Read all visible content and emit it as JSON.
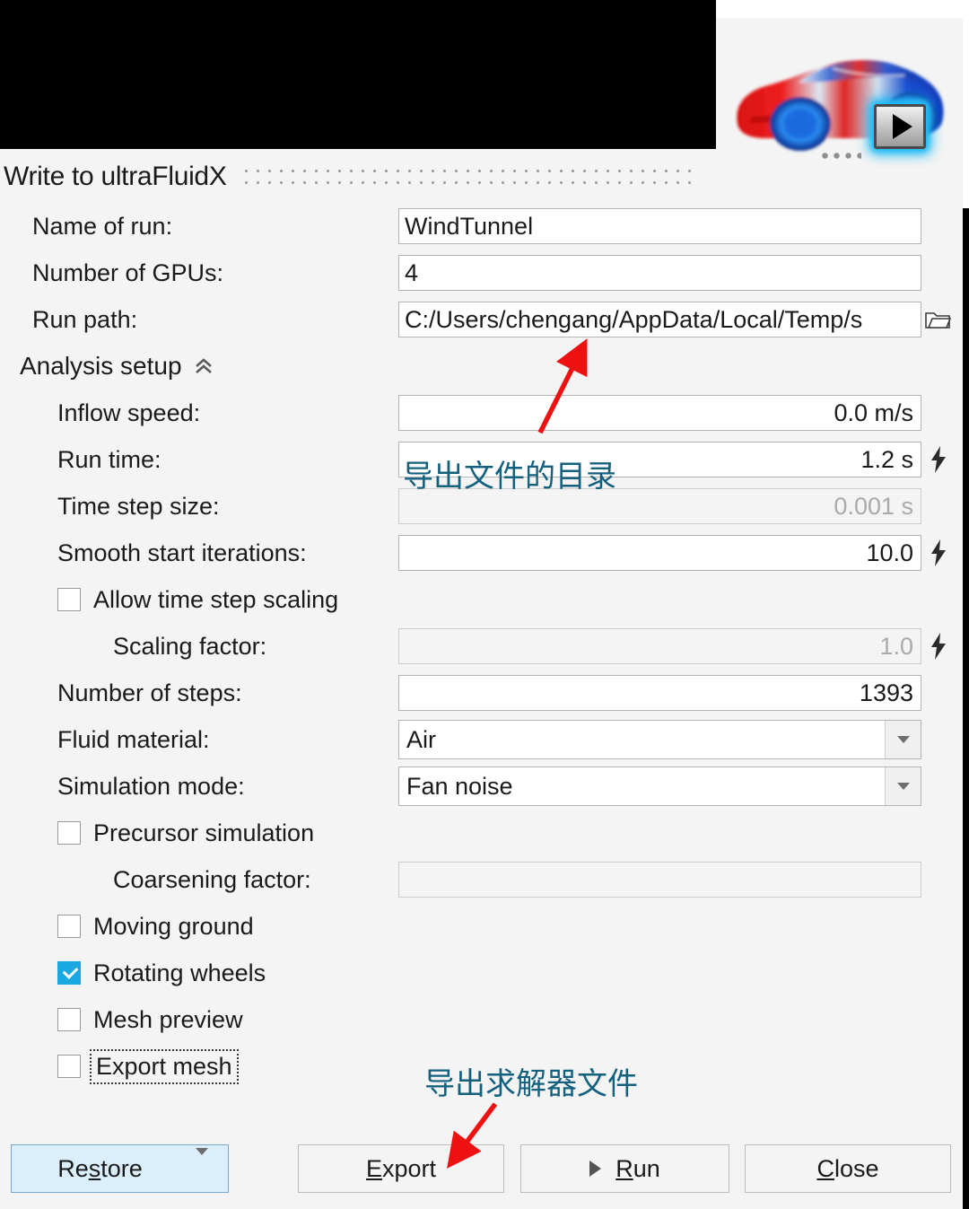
{
  "window": {
    "title": "Write to ultraFluidX",
    "icon_name": "cfd-car-icon",
    "play_badge_name": "play-icon"
  },
  "fields": {
    "name_of_run": {
      "label": "Name of run:",
      "value": "WindTunnel"
    },
    "number_of_gpus": {
      "label": "Number of GPUs:",
      "value": "4"
    },
    "run_path": {
      "label": "Run path:",
      "value": "C:/Users/chengang/AppData/Local/Temp/s",
      "browse_icon": "folder-icon"
    }
  },
  "analysis_setup": {
    "header": "Analysis setup",
    "collapse_icon": "chevron-double-up-icon",
    "rows": [
      {
        "label": "Inflow speed:",
        "value": "0.0 m/s",
        "disabled": false,
        "bolt": false
      },
      {
        "label": "Run time:",
        "value": "1.2 s",
        "disabled": false,
        "bolt": true
      },
      {
        "label": "Time step size:",
        "value": "0.001 s",
        "disabled": true,
        "bolt": false
      },
      {
        "label": "Smooth start iterations:",
        "value": "10.0",
        "disabled": false,
        "bolt": true
      }
    ],
    "allow_time_step_scaling": {
      "label": "Allow time step scaling",
      "checked": false
    },
    "scaling_factor": {
      "label": "Scaling factor:",
      "value": "1.0",
      "disabled": true,
      "bolt": true
    },
    "number_of_steps": {
      "label": "Number of steps:",
      "value": "1393"
    },
    "fluid_material": {
      "label": "Fluid material:",
      "value": "Air"
    },
    "simulation_mode": {
      "label": "Simulation mode:",
      "value": "Fan noise"
    },
    "precursor_simulation": {
      "label": "Precursor simulation",
      "checked": false
    },
    "coarsening_factor": {
      "label": "Coarsening factor:",
      "value": "",
      "disabled": true
    },
    "moving_ground": {
      "label": "Moving ground",
      "checked": false
    },
    "rotating_wheels": {
      "label": "Rotating wheels",
      "checked": true
    },
    "mesh_preview": {
      "label": "Mesh preview",
      "checked": false
    },
    "export_mesh": {
      "label": "Export mesh",
      "checked": false,
      "focused": true
    }
  },
  "footer": {
    "restore": {
      "label": "Re",
      "mnemonic": "s",
      "rest": "tore",
      "full": "Restore",
      "arrow_icon": "chevron-down-icon"
    },
    "export": {
      "pre": "",
      "mnemonic": "E",
      "rest": "xport",
      "full": "Export"
    },
    "run": {
      "pre": "",
      "mnemonic": "R",
      "rest": "un",
      "full": "Run",
      "play_icon": "play-triangle-icon"
    },
    "close": {
      "pre": "",
      "mnemonic": "C",
      "rest": "lose",
      "full": "Close"
    }
  },
  "annotations": {
    "directory_note": "导出文件的目录",
    "export_note": "导出求解器文件",
    "arrow_color": "#ee1111",
    "note_color": "#14607f"
  },
  "colors": {
    "panel_bg": "#f4f4f4",
    "accent_checkbox": "#19a8e0",
    "restore_bg": "#dbeefb",
    "text": "#1a1a1a",
    "disabled_text": "#aaaaaa"
  }
}
